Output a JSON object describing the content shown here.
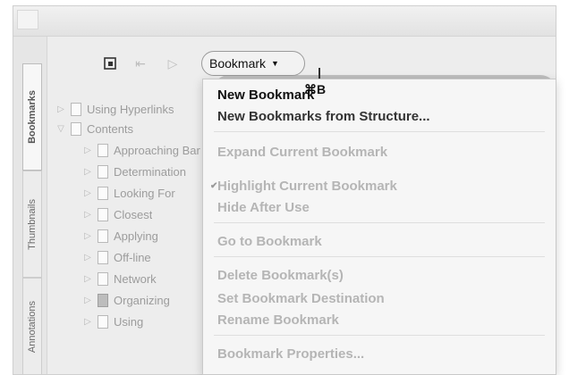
{
  "toolbar": {
    "bookmark_label": "Bookmark",
    "icons": [
      "page-icon",
      "arrow-icon",
      "forward-icon"
    ]
  },
  "sidetabs": [
    "Bookmarks",
    "Thumbnails",
    "Annotations"
  ],
  "tree": {
    "items": [
      {
        "label": "Using Hyperlinks",
        "indent": 0
      },
      {
        "label": "Contents",
        "indent": 0
      },
      {
        "label": "Approaching Bar",
        "indent": 1
      },
      {
        "label": "Determination",
        "indent": 1
      },
      {
        "label": "Looking For",
        "indent": 1
      },
      {
        "label": "Closest",
        "indent": 1
      },
      {
        "label": "Applying",
        "indent": 1
      },
      {
        "label": "Off-line",
        "indent": 1
      },
      {
        "label": "Network",
        "indent": 1
      },
      {
        "label": "Organizing",
        "indent": 1
      },
      {
        "label": "Using",
        "indent": 1
      }
    ]
  },
  "menu": {
    "items": [
      {
        "label": "New Bookmark",
        "shortcut": "⌘B",
        "enabled": true
      },
      {
        "label": "New Bookmarks from Structure...",
        "enabled": false
      },
      {
        "label": "Expand Current Bookmark",
        "enabled": false
      },
      {
        "label": "Highlight Current Bookmark",
        "enabled": false,
        "checked": true
      },
      {
        "label": "Hide After Use",
        "enabled": false
      },
      {
        "label": "Go to Bookmark",
        "enabled": false
      },
      {
        "label": "Delete Bookmark(s)",
        "enabled": false
      },
      {
        "label": "Set Bookmark Destination",
        "enabled": false
      },
      {
        "label": "Rename Bookmark",
        "enabled": false
      },
      {
        "label": "Bookmark Properties...",
        "enabled": false
      }
    ]
  }
}
